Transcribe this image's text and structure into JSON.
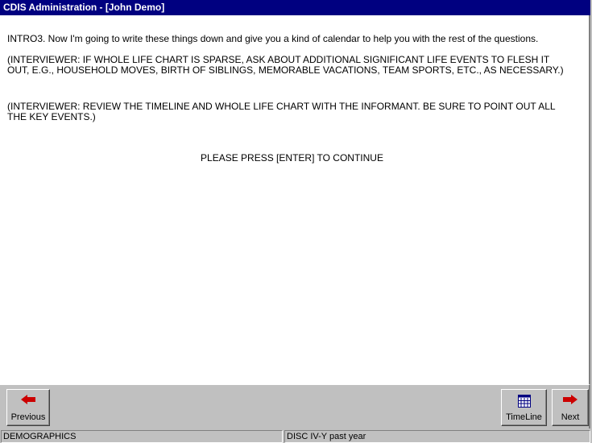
{
  "window": {
    "title": "CDIS Administration - [John Demo]"
  },
  "content": {
    "intro": "INTRO3. Now I'm going to write these things down and give you a kind of calendar to help you with the rest of the questions.",
    "instruction1": "(INTERVIEWER: IF WHOLE LIFE CHART IS SPARSE, ASK ABOUT ADDITIONAL SIGNIFICANT LIFE EVENTS TO FLESH IT OUT, E.G., HOUSEHOLD MOVES, BIRTH OF SIBLINGS, MEMORABLE VACATIONS, TEAM SPORTS, ETC., AS NECESSARY.)",
    "instruction2": "(INTERVIEWER: REVIEW THE TIMELINE AND WHOLE LIFE CHART WITH THE INFORMANT. BE SURE TO POINT OUT ALL THE KEY EVENTS.)",
    "continue_prompt": "PLEASE PRESS [ENTER] TO CONTINUE"
  },
  "toolbar": {
    "previous_label": "Previous",
    "timeline_label": "TimeLine",
    "next_label": "Next",
    "previous_icon": "left-arrow-icon",
    "timeline_icon": "calendar-icon",
    "next_icon": "right-arrow-icon",
    "arrow_color": "#cc0000"
  },
  "status": {
    "section": "DEMOGRAPHICS",
    "module": "DISC IV-Y past year"
  }
}
